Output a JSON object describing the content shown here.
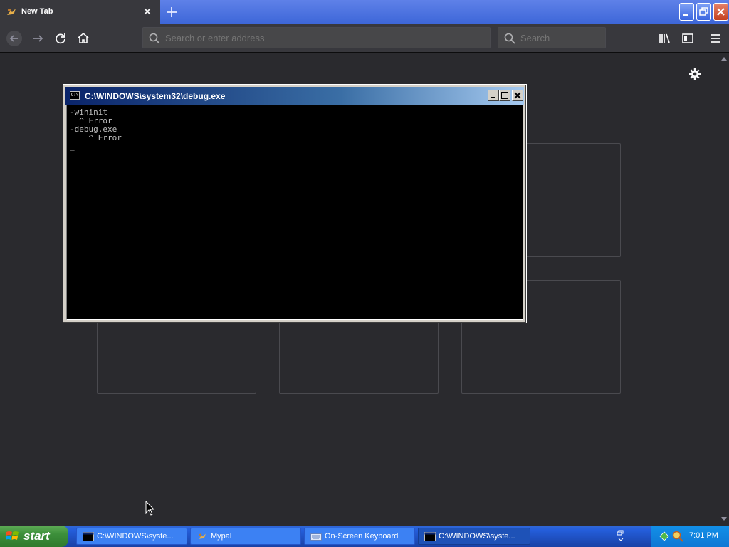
{
  "browser": {
    "tab_title": "New Tab",
    "url_placeholder": "Search or enter address",
    "search_placeholder": "Search"
  },
  "console": {
    "title": "C:\\WINDOWS\\system32\\debug.exe",
    "icon_text": "C:\\",
    "output": "-wininit\n  ^ Error\n-debug.exe\n    ^ Error\n_"
  },
  "taskbar": {
    "start_label": "start",
    "items": [
      {
        "label": "C:\\WINDOWS\\syste...",
        "icon": "console-icon"
      },
      {
        "label": "Mypal",
        "icon": "mypal-icon"
      },
      {
        "label": "On-Screen Keyboard",
        "icon": "keyboard-icon"
      },
      {
        "label": "C:\\WINDOWS\\syste...",
        "icon": "console-icon",
        "active": true
      }
    ],
    "clock": "7:01 PM"
  },
  "colors": {
    "browser_chrome": "#38383d",
    "content_bg": "#2a2a2e",
    "xp_blue": "#245edb",
    "start_green": "#3c8f3a"
  }
}
